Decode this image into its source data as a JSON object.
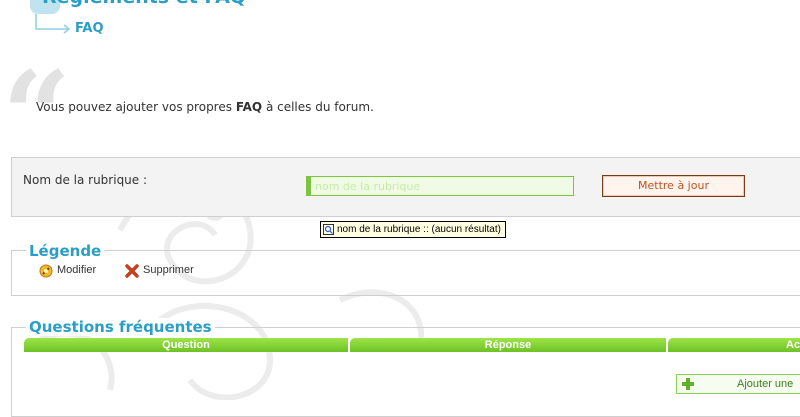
{
  "header": {
    "section_title": "Règlements et FAQ",
    "breadcrumb_current": "FAQ"
  },
  "intro": {
    "text_before": "Vous pouvez ajouter vos propres ",
    "text_bold": "FAQ",
    "text_after": " à celles du forum."
  },
  "form": {
    "label": "Nom de la rubrique :",
    "input_value": "",
    "input_placeholder": "nom de la rubrique",
    "update_button_label": "Mettre à jour"
  },
  "tooltip": {
    "text": "nom de la rubrique :: (aucun résultat)"
  },
  "legend": {
    "title": "Légende",
    "items": [
      {
        "label": "Modifier",
        "icon": "edit-icon"
      },
      {
        "label": "Supprimer",
        "icon": "delete-icon"
      }
    ]
  },
  "faq": {
    "title": "Questions fréquentes",
    "columns": [
      "Question",
      "Réponse",
      "Ac"
    ],
    "add_button_label": "Ajouter une"
  },
  "colors": {
    "accent": "#2a9ec4",
    "green": "#7cc43f",
    "button_text": "#c2501d"
  }
}
